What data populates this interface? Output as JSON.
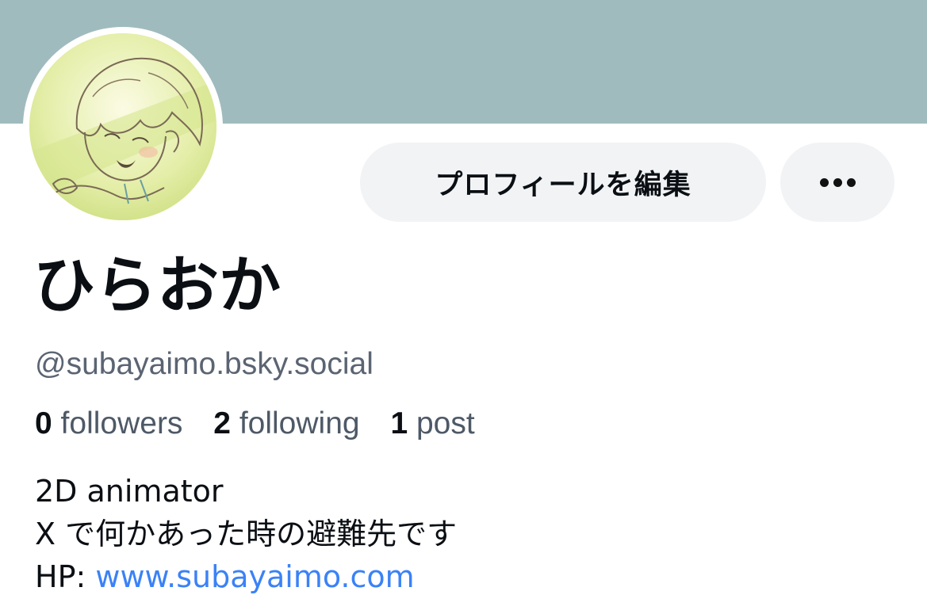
{
  "profile": {
    "display_name": "ひらおか",
    "handle": "@subayaimo.bsky.social",
    "avatar_icon": "anime-character-sketch-avatar"
  },
  "actions": {
    "edit_profile_label": "プロフィールを編集",
    "more_icon": "more-horizontal-icon"
  },
  "stats": {
    "followers_count": "0",
    "followers_label": "followers",
    "following_count": "2",
    "following_label": "following",
    "posts_count": "1",
    "posts_label": "post"
  },
  "bio": {
    "line1": "2D animator",
    "line2": "X で何かあった時の避難先です",
    "hp_label": "HP: ",
    "hp_link": "www.subayaimo.com"
  },
  "colors": {
    "banner": "#a0bbbd",
    "button_bg": "#f1f3f5",
    "link": "#3a82f7",
    "muted_text": "#5b6472"
  }
}
